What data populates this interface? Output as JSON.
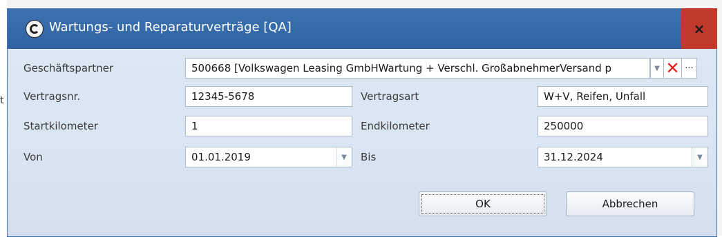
{
  "window": {
    "title": "Wartungs- und Reparaturverträge [QA]",
    "close_label": "×"
  },
  "form": {
    "partner_label": "Geschäftspartner",
    "partner_value": "500668 [Volkswagen Leasing GmbHWartung + Verschl. GroßabnehmerVersand p",
    "contract_no_label": "Vertragsnr.",
    "contract_no_value": "12345-5678",
    "contract_type_label": "Vertragsart",
    "contract_type_value": "W+V, Reifen, Unfall",
    "start_km_label": "Startkilometer",
    "start_km_value": "1",
    "end_km_label": "Endkilometer",
    "end_km_value": "250000",
    "from_label": "Von",
    "from_value": "01.01.2019",
    "to_label": "Bis",
    "to_value": "31.12.2024"
  },
  "buttons": {
    "ok_label": "OK",
    "cancel_label": "Abbrechen"
  },
  "icons": {
    "dropdown": "▼",
    "clear": "✕",
    "more": "···"
  },
  "background": {
    "fragment_left": "t"
  }
}
